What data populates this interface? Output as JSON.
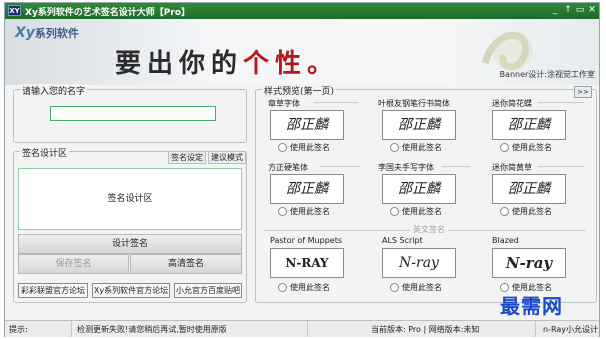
{
  "window": {
    "title": "Xy系列软件の艺术签名设计大师【Pro】",
    "app_icon": "XY",
    "controls": [
      "_",
      "↑",
      "▭",
      "✕"
    ]
  },
  "banner": {
    "logo": "系列软件",
    "logo_mark": "Xy",
    "slogan_black": "要出你的",
    "slogan_red": "个性。",
    "credit": "Banner设计:涂视觉工作室"
  },
  "name_panel": {
    "legend": "请输入您的名字",
    "value": ""
  },
  "design_panel": {
    "legend": "签名设计区",
    "tab_settings": "签名设定",
    "tab_suggest": "建议模式",
    "area_label": "签名设计区",
    "design_btn": "设计签名",
    "save_btn": "保存签名",
    "hd_btn": "高清签名",
    "links": [
      "彩彩联盟官方论坛",
      "Xy系列软件官方论坛",
      "小允官方百度贴吧"
    ]
  },
  "preview_panel": {
    "legend": "样式预览(第一页)",
    "next_btn": ">>",
    "use_label": "使用此签名",
    "cn_cards": [
      {
        "title": "章草字体",
        "sample": "邵正麟"
      },
      {
        "title": "叶根友钢笔行书简体",
        "sample": "邵正麟"
      },
      {
        "title": "迷你简花蝶",
        "sample": "邵正麟"
      },
      {
        "title": "方正硬笔体",
        "sample": "邵正麟"
      },
      {
        "title": "李国夫手写字体",
        "sample": "邵正麟"
      },
      {
        "title": "迷你简黄草",
        "sample": "邵正麟"
      }
    ],
    "en_section": "英文签名",
    "en_cards": [
      {
        "title": "Pastor of Muppets",
        "sample": "N-RAY"
      },
      {
        "title": "ALS Script",
        "sample": "N-ray"
      },
      {
        "title": "Blazed",
        "sample": "N-ray"
      }
    ]
  },
  "status": {
    "hint_label": "提示:",
    "message": "检测更新失败!请您稍后再试,暂时使用原版",
    "version": "当前版本: Pro | 网络版本:未知",
    "author": "n-Ray小允设计"
  },
  "watermark": "最需网",
  "colors": {
    "title_green": "#2f8a3a",
    "input_border": "#43b06a",
    "slogan_red": "#b31a1a",
    "watermark_blue": "#1a49c9"
  }
}
